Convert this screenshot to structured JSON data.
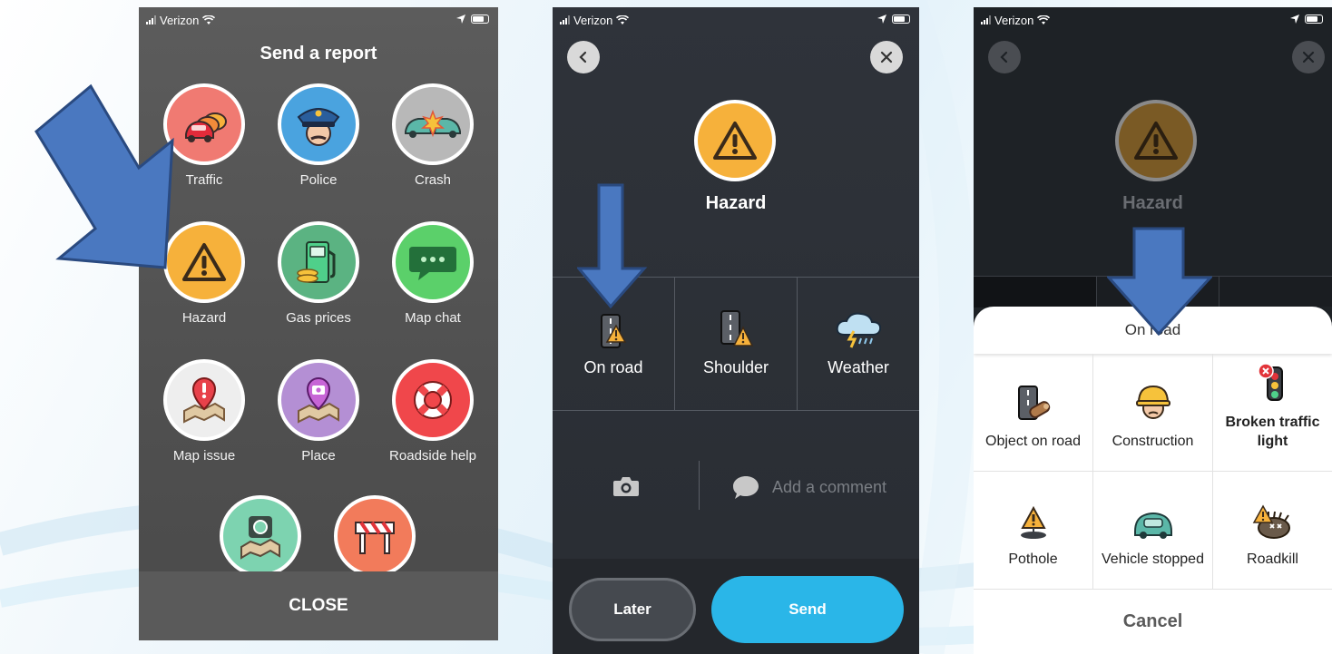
{
  "carrier": "Verizon",
  "screen1": {
    "title": "Send a report",
    "items": [
      {
        "label": "Traffic",
        "icon": "traffic-icon",
        "color": "#f07a72"
      },
      {
        "label": "Police",
        "icon": "police-icon",
        "color": "#4aa3df"
      },
      {
        "label": "Crash",
        "icon": "crash-icon",
        "color": "#b8b8b8"
      },
      {
        "label": "Hazard",
        "icon": "hazard-icon",
        "color": "#f6b13b"
      },
      {
        "label": "Gas prices",
        "icon": "gas-pump-icon",
        "color": "#5bb382"
      },
      {
        "label": "Map chat",
        "icon": "chat-icon",
        "color": "#5bd06a"
      },
      {
        "label": "Map issue",
        "icon": "map-issue-icon",
        "color": "#eeeeee"
      },
      {
        "label": "Place",
        "icon": "place-icon",
        "color": "#b48fd4"
      },
      {
        "label": "Roadside help",
        "icon": "lifebuoy-icon",
        "color": "#f0474b"
      },
      {
        "label": "",
        "icon": "camera-icon",
        "color": "#7dd3b0"
      },
      {
        "label": "",
        "icon": "closure-icon",
        "color": "#f27b5b"
      }
    ],
    "close_label": "CLOSE"
  },
  "screen2": {
    "title": "Hazard",
    "options": [
      {
        "label": "On road",
        "icon": "on-road-icon"
      },
      {
        "label": "Shoulder",
        "icon": "shoulder-icon"
      },
      {
        "label": "Weather",
        "icon": "weather-icon"
      }
    ],
    "comment_placeholder": "Add a comment",
    "later_label": "Later",
    "send_label": "Send",
    "send_color": "#2ab6e8"
  },
  "screen3": {
    "title": "Hazard",
    "sheet_title": "On road",
    "items": [
      {
        "label": "Object on road",
        "icon": "object-on-road-icon"
      },
      {
        "label": "Construction",
        "icon": "construction-icon"
      },
      {
        "label": "Broken traffic light",
        "icon": "broken-traffic-light-icon"
      },
      {
        "label": "Pothole",
        "icon": "pothole-icon"
      },
      {
        "label": "Vehicle stopped",
        "icon": "vehicle-stopped-icon"
      },
      {
        "label": "Roadkill",
        "icon": "roadkill-icon"
      }
    ],
    "cancel_label": "Cancel"
  },
  "arrow_color": "#4a78c0"
}
